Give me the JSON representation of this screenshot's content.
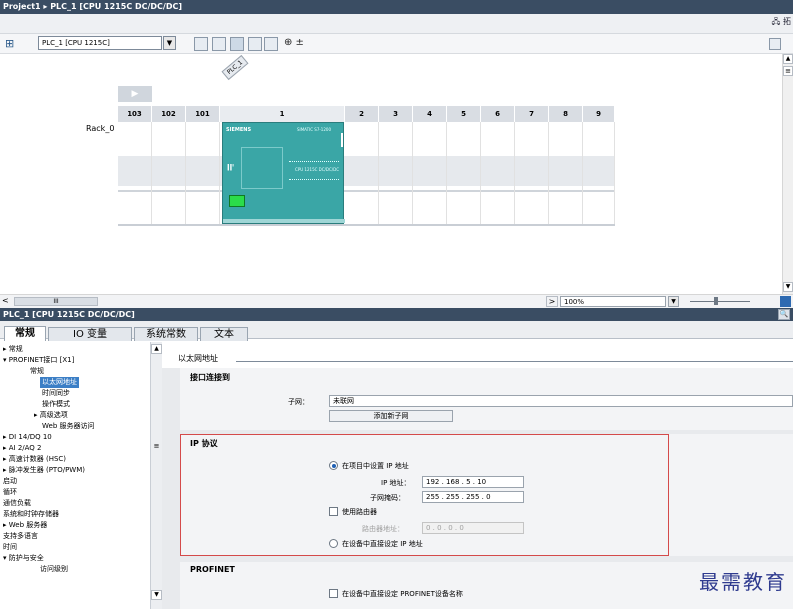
{
  "titlebar": {
    "text": "Project1 ▸ PLC_1 [CPU 1215C DC/DC/DC]"
  },
  "topology_button": "拓",
  "toolbar": {
    "device_select": "PLC_1 [CPU 1215C]",
    "zoom_icons": [
      "⊕ ±"
    ]
  },
  "rack": {
    "label": "Rack_0",
    "device_tag": "PLC_1",
    "slots": [
      "103",
      "102",
      "101",
      "1",
      "2",
      "3",
      "4",
      "5",
      "6",
      "7",
      "8",
      "9"
    ],
    "module_brand": "SIEMENS",
    "module_model": "SIMATIC S7-1200",
    "module_caption": "CPU 1215C DC/DC/DC"
  },
  "hscroll": {
    "zoom": "100%",
    "scroll_mark": "III"
  },
  "props_title": "PLC_1 [CPU 1215C DC/DC/DC]",
  "tabs": [
    "常规",
    "IO 变量",
    "系统常数",
    "文本"
  ],
  "tree": [
    {
      "label": "常规",
      "indent": 0,
      "arrow": "▸"
    },
    {
      "label": "PROFINET接口 [X1]",
      "indent": 0,
      "arrow": "▾"
    },
    {
      "label": "常规",
      "indent": 2,
      "arrow": ""
    },
    {
      "label": "以太网地址",
      "indent": 2,
      "arrow": "",
      "selected": true
    },
    {
      "label": "时间同步",
      "indent": 2,
      "arrow": ""
    },
    {
      "label": "操作模式",
      "indent": 2,
      "arrow": ""
    },
    {
      "label": "高级选项",
      "indent": 1,
      "arrow": "▸"
    },
    {
      "label": "Web 服务器访问",
      "indent": 2,
      "arrow": ""
    },
    {
      "label": "DI 14/DQ 10",
      "indent": 0,
      "arrow": "▸"
    },
    {
      "label": "AI 2/AQ 2",
      "indent": 0,
      "arrow": "▸"
    },
    {
      "label": "高速计数器 (HSC)",
      "indent": 0,
      "arrow": "▸"
    },
    {
      "label": "脉冲发生器 (PTO/PWM)",
      "indent": 0,
      "arrow": "▸"
    },
    {
      "label": "启动",
      "indent": 0,
      "arrow": ""
    },
    {
      "label": "循环",
      "indent": 0,
      "arrow": ""
    },
    {
      "label": "通信负载",
      "indent": 0,
      "arrow": ""
    },
    {
      "label": "系统和时钟存储器",
      "indent": 0,
      "arrow": ""
    },
    {
      "label": "Web 服务器",
      "indent": 0,
      "arrow": "▸"
    },
    {
      "label": "支持多语言",
      "indent": 0,
      "arrow": ""
    },
    {
      "label": "时间",
      "indent": 0,
      "arrow": ""
    },
    {
      "label": "防护与安全",
      "indent": 0,
      "arrow": "▾"
    },
    {
      "label": "访问级别",
      "indent": 2,
      "arrow": ""
    }
  ],
  "content": {
    "section_title": "以太网地址",
    "interface_header": "接口连接到",
    "subnet_label": "子网：",
    "subnet_value": "未联网",
    "add_subnet_button": "添加新子网",
    "ip_header": "IP 协议",
    "radio_project": "在项目中设置 IP 地址",
    "ip_label": "IP 地址：",
    "ip_value": "192 . 168 . 5 . 10",
    "mask_label": "子网掩码：",
    "mask_value": "255 . 255 . 255 . 0",
    "use_router": "使用路由器",
    "router_label": "路由器地址：",
    "router_value": "0 . 0 . 0 . 0",
    "radio_device": "在设备中直接设定 IP 地址",
    "profinet_header": "PROFINET",
    "profinet_check": "在设备中直接设定 PROFINET设备名称"
  },
  "watermark": "最需教育",
  "colors": {
    "titlebar": "#3a4d63",
    "module": "#3aa6a6",
    "selected": "#3c7fc6",
    "ip_frame": "#d44a4a"
  }
}
